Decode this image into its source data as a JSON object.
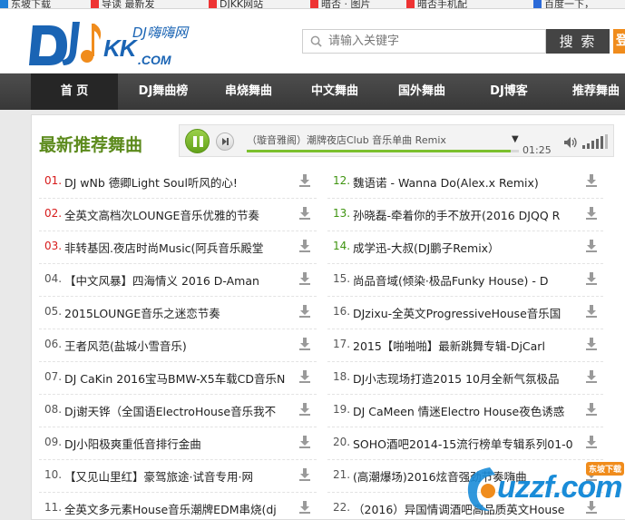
{
  "bookmarks": [
    {
      "label": "东坡下载",
      "color": "#1e7ed6"
    },
    {
      "label": "导读 最新发",
      "color": "#e33"
    },
    {
      "label": "DJKK网站",
      "color": "#e33"
    },
    {
      "label": "暗否 · 图片",
      "color": "#e33"
    },
    {
      "label": "暗否手机配",
      "color": "#e33"
    },
    {
      "label": "百度一下，",
      "color": "#2b6ad8"
    }
  ],
  "logo": {
    "dj_text": "DJ嗨嗨网",
    "kk": "KK",
    "com": ".COM"
  },
  "search": {
    "placeholder": "请输入关键字",
    "button": "搜 索",
    "extra": "登"
  },
  "nav": [
    {
      "label": "首 页",
      "active": true
    },
    {
      "label": "DJ舞曲榜",
      "active": false
    },
    {
      "label": "串烧舞曲",
      "active": false
    },
    {
      "label": "中文舞曲",
      "active": false
    },
    {
      "label": "国外舞曲",
      "active": false
    },
    {
      "label": "DJ博客",
      "active": false
    },
    {
      "label": "推荐舞曲",
      "active": false
    }
  ],
  "section": {
    "title": "最新推荐舞曲"
  },
  "player": {
    "track": "（璇音雅阁）潮牌夜店Club 音乐单曲 Remix",
    "time": "01:25",
    "progress": 0.97,
    "volume_level": 5
  },
  "songs_left": [
    {
      "num": "01.",
      "title": "DJ wNb 德卿Light Soul听风的心!",
      "num_color": "red"
    },
    {
      "num": "02.",
      "title": "全英文高档次LOUNGE音乐优雅的节奏",
      "num_color": "red"
    },
    {
      "num": "03.",
      "title": "非转基因.夜店时尚Music(阿兵音乐殿堂",
      "num_color": "red"
    },
    {
      "num": "04.",
      "title": "【中文风暴】四海情义 2016 D-Aman",
      "num_color": "gray"
    },
    {
      "num": "05.",
      "title": "2015LOUNGE音乐之迷恋节奏",
      "num_color": "gray"
    },
    {
      "num": "06.",
      "title": "王者风范(盐城小雪音乐)",
      "num_color": "gray"
    },
    {
      "num": "07.",
      "title": "DJ CaKin 2016宝马BMW-X5车载CD音乐N",
      "num_color": "gray"
    },
    {
      "num": "08.",
      "title": "Dj谢天铧（全国语ElectroHouse音乐我不",
      "num_color": "gray"
    },
    {
      "num": "09.",
      "title": "DJ小阳极爽重低音排行金曲",
      "num_color": "gray"
    },
    {
      "num": "10.",
      "title": "【又见山里红】豪驾旅途·试音专用·网",
      "num_color": "gray"
    },
    {
      "num": "11.",
      "title": "全英文多元素House音乐潮牌EDM串烧(dj",
      "num_color": "gray"
    }
  ],
  "songs_right": [
    {
      "num": "12.",
      "title": "魏语诺 - Wanna Do(Alex.x Remix)",
      "num_color": "green"
    },
    {
      "num": "13.",
      "title": "孙晓磊-牵着你的手不放开(2016 DJQQ R",
      "num_color": "green"
    },
    {
      "num": "14.",
      "title": "成学迅-大叔(DJ鹏子Remix）",
      "num_color": "green"
    },
    {
      "num": "15.",
      "title": "尚品音域(倾染·极品Funky House) - D",
      "num_color": "gray"
    },
    {
      "num": "16.",
      "title": "DJzixu-全英文ProgressiveHouse音乐国",
      "num_color": "gray"
    },
    {
      "num": "17.",
      "title": "2015【啪啪啪】最新跳舞专辑-DjCarl",
      "num_color": "gray"
    },
    {
      "num": "18.",
      "title": "DJ小志现场打造2015 10月全新气氛极品",
      "num_color": "gray"
    },
    {
      "num": "19.",
      "title": "DJ CaMeen 情迷Electro House夜色诱惑",
      "num_color": "gray"
    },
    {
      "num": "20.",
      "title": "SOHO酒吧2014-15流行榜单专辑系列01-0",
      "num_color": "gray"
    },
    {
      "num": "21.",
      "title": "(高潮爆场)2016炫音强劲节奏嗨曲",
      "num_color": "gray"
    },
    {
      "num": "22.",
      "title": "（2016）异国情调酒吧高品质英文House",
      "num_color": "gray"
    }
  ],
  "watermark": {
    "text": "uzzf.com",
    "badge": "东坡下载"
  },
  "colors": {
    "accent_green": "#5c8a1c",
    "nav_bg": "#3d3d3d",
    "rank_red": "#d71b1b",
    "rank_green": "#3f9410",
    "brand_blue": "#1a64b4",
    "orange": "#f08c1c"
  }
}
